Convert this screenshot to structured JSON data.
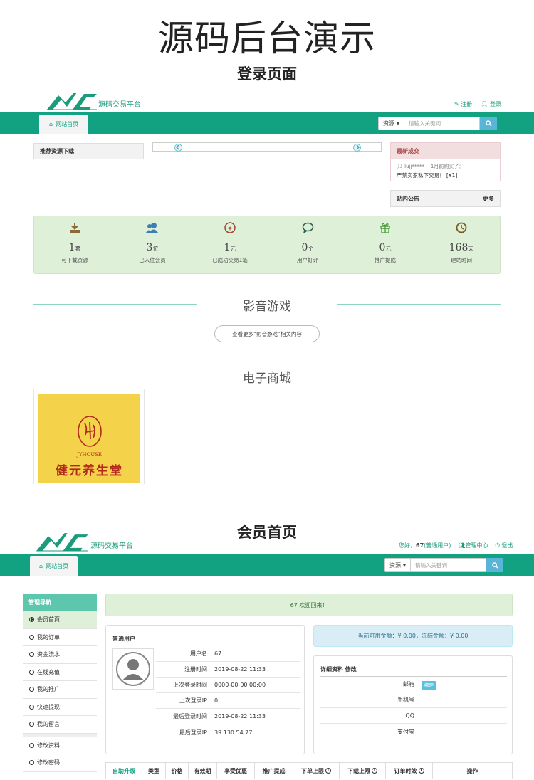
{
  "header": {
    "main_title": "源码后台演示",
    "login_title": "登录页面",
    "member_title": "会员首页"
  },
  "brand": {
    "logo_text": "源码交易平台",
    "accent": "#12a281",
    "light_green": "#def0d8"
  },
  "login_page": {
    "top_links": {
      "register": "注册",
      "login": "登录"
    },
    "nav": {
      "home": "网站首页"
    },
    "search": {
      "select": "资源",
      "placeholder": "请输入关键词"
    },
    "recommend_title": "推荐资源下载",
    "latest_deal": {
      "title": "最新成交",
      "user": "lujj*****",
      "time": "1月前购买了：",
      "item": "严禁卖家私下交易！ [¥1]"
    },
    "notice": {
      "title": "站内公告",
      "more": "更多"
    },
    "stats": [
      {
        "icon": "download-icon",
        "value": "1",
        "unit": "套",
        "label": "可下载资源"
      },
      {
        "icon": "users-icon",
        "value": "3",
        "unit": "位",
        "label": "已入住会员"
      },
      {
        "icon": "yen-icon",
        "value": "1",
        "unit": "元",
        "label": "已成功交易1笔"
      },
      {
        "icon": "comment-icon",
        "value": "0",
        "unit": "个",
        "label": "用户好评"
      },
      {
        "icon": "gift-icon",
        "value": "0",
        "unit": "元",
        "label": "推广提成"
      },
      {
        "icon": "clock-icon",
        "value": "168",
        "unit": "天",
        "label": "建站时间"
      }
    ],
    "section1": {
      "title": "影音游戏",
      "more_btn": "查看更多“影音游戏”相关内容"
    },
    "section2": {
      "title": "电子商城"
    },
    "product": {
      "brand_en": "JYHOUSE",
      "brand_cn": "健元养生堂"
    }
  },
  "member_page": {
    "top_links": {
      "greeting": "您好，",
      "user_id": "67",
      "user_type": "(普通用户)",
      "center": "管理中心",
      "logout": "退出"
    },
    "nav": {
      "home": "网站首页"
    },
    "search": {
      "select": "资源",
      "placeholder": "请输入关键词"
    },
    "sidebar": {
      "title": "管理导航",
      "group1": [
        "会员首页",
        "我的订单",
        "资金流水",
        "在线充值",
        "我的推广",
        "快速提现",
        "我的留言"
      ],
      "group2": [
        "修改资料",
        "修改密码"
      ]
    },
    "welcome": "67   欢迎回来！",
    "balance": "当前可用金额：¥ 0.00，冻结金额：¥ 0.00",
    "user_card": {
      "title": "普通用户",
      "rows": [
        {
          "k": "用户名",
          "v": "67"
        },
        {
          "k": "注册时间",
          "v": "2019-08-22 11:33"
        },
        {
          "k": "上次登录时间",
          "v": "0000-00-00 00:00"
        },
        {
          "k": "上次登录IP",
          "v": "0"
        },
        {
          "k": "最后登录时间",
          "v": "2019-08-22 11:33"
        },
        {
          "k": "最后登录IP",
          "v": "39.130.54.77"
        }
      ]
    },
    "detail_card": {
      "title": "详细资料 修改",
      "rows": [
        {
          "k": "邮箱",
          "badge": "绑定"
        },
        {
          "k": "手机号",
          "badge": ""
        },
        {
          "k": "QQ",
          "badge": ""
        },
        {
          "k": "支付宝",
          "badge": ""
        }
      ]
    },
    "table_headers": [
      "自助升级",
      "类型",
      "价格",
      "有效期",
      "享受优惠",
      "推广提成",
      "下单上限",
      "下载上限",
      "订单时效",
      "操作"
    ]
  }
}
